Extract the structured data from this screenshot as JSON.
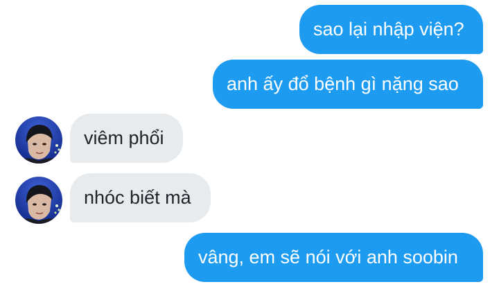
{
  "conversation": {
    "messages": [
      {
        "sender": "me",
        "text": "sao lại nhập viện?"
      },
      {
        "sender": "me",
        "text": "anh ấy đổ bệnh gì nặng sao"
      },
      {
        "sender": "other",
        "text": "viêm phổi"
      },
      {
        "sender": "other",
        "text": "nhóc biết mà"
      },
      {
        "sender": "me",
        "text": "vâng, em sẽ nói với anh soobin"
      }
    ]
  },
  "colors": {
    "sent_bubble": "#1d9bf0",
    "received_bubble": "#e7ebee",
    "avatar_background": "#1b3aa8"
  }
}
